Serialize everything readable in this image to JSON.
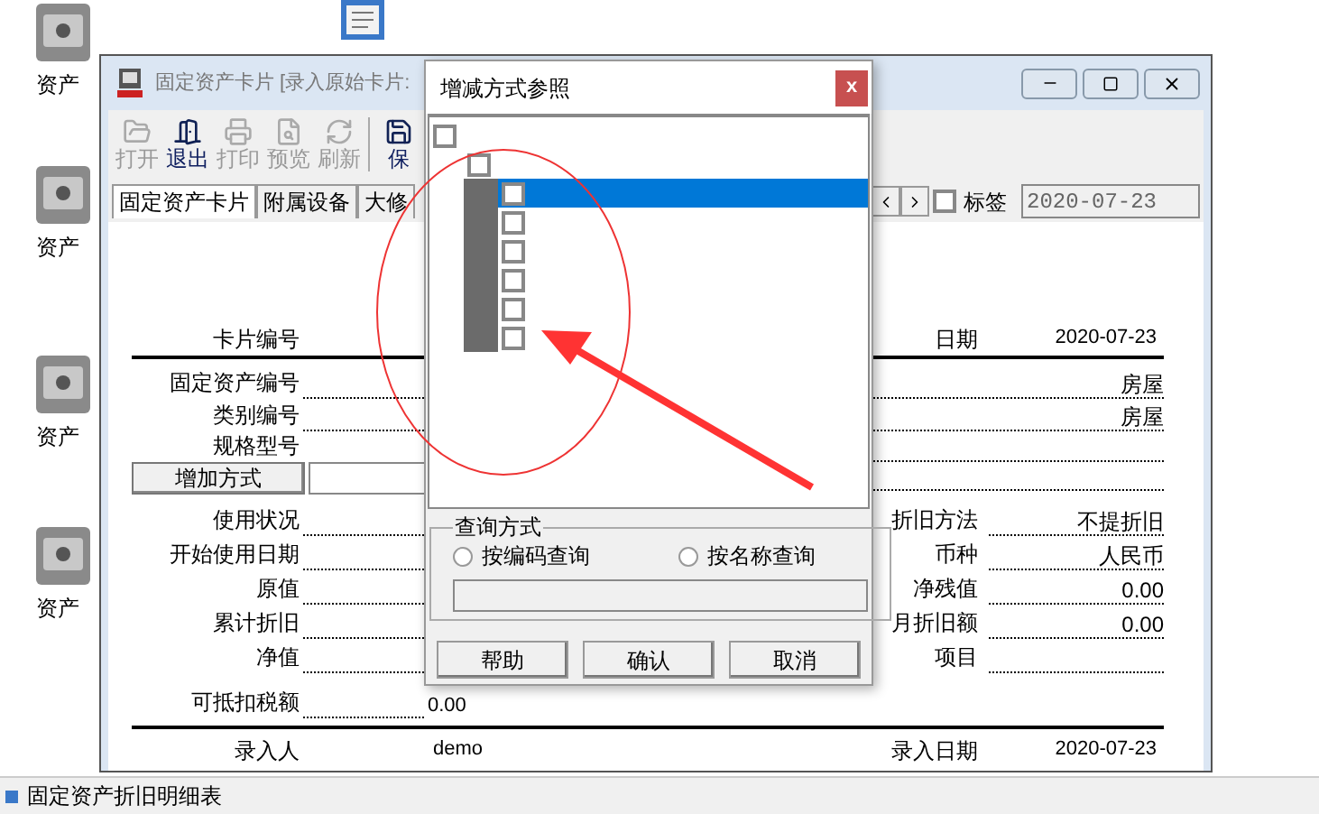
{
  "desktop_icons": [
    {
      "label": "资产"
    },
    {
      "label": "资产"
    },
    {
      "label": "资产"
    },
    {
      "label": "资产"
    }
  ],
  "window": {
    "title": "固定资产卡片 [录入原始卡片:"
  },
  "toolbar": [
    {
      "label": "打开",
      "disabled": true
    },
    {
      "label": "退出",
      "disabled": false
    },
    {
      "label": "打印",
      "disabled": true
    },
    {
      "label": "预览",
      "disabled": true
    },
    {
      "label": "刷新",
      "disabled": true
    },
    {
      "label": "保",
      "disabled": false
    }
  ],
  "tabs": [
    {
      "label": "固定资产卡片",
      "selected": true
    },
    {
      "label": "附属设备",
      "selected": false
    },
    {
      "label": "大修",
      "selected": false
    }
  ],
  "tag_checkbox": {
    "label": "标签",
    "checked": false
  },
  "tag_field": {
    "value": "2020-07-23"
  },
  "card": {
    "header": {
      "left_label": "卡片编号",
      "right_label": "日期",
      "right_value": "2020-07-23"
    },
    "rows": [
      {
        "left": {
          "kind": "field",
          "label": "固定资产编号"
        },
        "right": {
          "value": "房屋"
        }
      },
      {
        "left": {
          "kind": "field",
          "label": "类别编号"
        },
        "right": {
          "value": "房屋"
        }
      },
      {
        "left": {
          "kind": "label",
          "label": "规格型号"
        },
        "right": {}
      },
      {
        "left": {
          "kind": "button",
          "label": "增加方式"
        },
        "right": {}
      },
      {
        "left": {
          "kind": "field",
          "label": "使用状况"
        },
        "right": {
          "label": "折旧方法",
          "value": "不提折旧"
        }
      },
      {
        "left": {
          "kind": "field",
          "label": "开始使用日期"
        },
        "right": {
          "label": "币种",
          "value": "人民币"
        }
      },
      {
        "left": {
          "kind": "field",
          "label": "原值"
        },
        "right": {
          "label": "净残值",
          "value": "0.00"
        }
      },
      {
        "left": {
          "kind": "field",
          "label": "累计折旧"
        },
        "right": {
          "label": "月折旧额",
          "value": "0.00"
        }
      },
      {
        "left": {
          "kind": "field",
          "label": "净值"
        },
        "right": {
          "label": "项目"
        }
      },
      {
        "left": {
          "kind": "field",
          "label": "可抵扣税额",
          "value": "0.00"
        }
      }
    ],
    "footer": {
      "left_label": "录入人",
      "left_value": "demo",
      "right_label": "录入日期",
      "right_value": "2020-07-23"
    }
  },
  "dialog": {
    "title": "增减方式参照",
    "close": "x",
    "tree": [
      {
        "checked": false,
        "selected": false,
        "children": [
          {
            "checked": false,
            "selected": false,
            "children": [
              {
                "checked": false,
                "selected": true
              },
              {
                "checked": false,
                "selected": false
              },
              {
                "checked": false,
                "selected": false
              },
              {
                "checked": false,
                "selected": false
              },
              {
                "checked": false,
                "selected": false
              },
              {
                "checked": false,
                "selected": false
              }
            ]
          }
        ]
      }
    ],
    "query": {
      "legend": "查询方式",
      "options": [
        {
          "label": "按编码查询",
          "selected": false
        },
        {
          "label": "按名称查询",
          "selected": false
        }
      ]
    },
    "buttons": [
      "帮助",
      "确认",
      "取消"
    ]
  },
  "taskbar": {
    "label": "固定资产折旧明细表"
  }
}
